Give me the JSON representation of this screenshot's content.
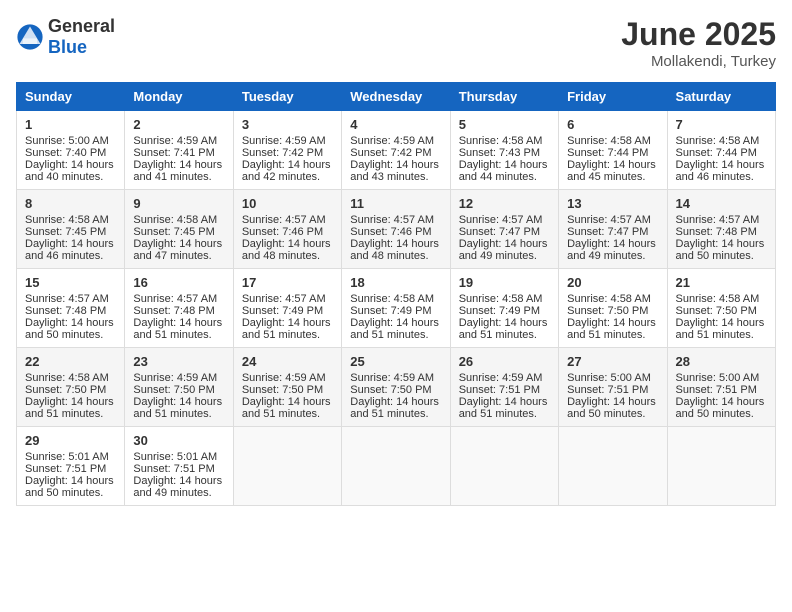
{
  "header": {
    "logo_general": "General",
    "logo_blue": "Blue",
    "title": "June 2025",
    "location": "Mollakendi, Turkey"
  },
  "weekdays": [
    "Sunday",
    "Monday",
    "Tuesday",
    "Wednesday",
    "Thursday",
    "Friday",
    "Saturday"
  ],
  "weeks": [
    [
      {
        "day": "1",
        "sunrise": "5:00 AM",
        "sunset": "7:40 PM",
        "daylight": "14 hours and 40 minutes."
      },
      {
        "day": "2",
        "sunrise": "4:59 AM",
        "sunset": "7:41 PM",
        "daylight": "14 hours and 41 minutes."
      },
      {
        "day": "3",
        "sunrise": "4:59 AM",
        "sunset": "7:42 PM",
        "daylight": "14 hours and 42 minutes."
      },
      {
        "day": "4",
        "sunrise": "4:59 AM",
        "sunset": "7:42 PM",
        "daylight": "14 hours and 43 minutes."
      },
      {
        "day": "5",
        "sunrise": "4:58 AM",
        "sunset": "7:43 PM",
        "daylight": "14 hours and 44 minutes."
      },
      {
        "day": "6",
        "sunrise": "4:58 AM",
        "sunset": "7:44 PM",
        "daylight": "14 hours and 45 minutes."
      },
      {
        "day": "7",
        "sunrise": "4:58 AM",
        "sunset": "7:44 PM",
        "daylight": "14 hours and 46 minutes."
      }
    ],
    [
      {
        "day": "8",
        "sunrise": "4:58 AM",
        "sunset": "7:45 PM",
        "daylight": "14 hours and 46 minutes."
      },
      {
        "day": "9",
        "sunrise": "4:58 AM",
        "sunset": "7:45 PM",
        "daylight": "14 hours and 47 minutes."
      },
      {
        "day": "10",
        "sunrise": "4:57 AM",
        "sunset": "7:46 PM",
        "daylight": "14 hours and 48 minutes."
      },
      {
        "day": "11",
        "sunrise": "4:57 AM",
        "sunset": "7:46 PM",
        "daylight": "14 hours and 48 minutes."
      },
      {
        "day": "12",
        "sunrise": "4:57 AM",
        "sunset": "7:47 PM",
        "daylight": "14 hours and 49 minutes."
      },
      {
        "day": "13",
        "sunrise": "4:57 AM",
        "sunset": "7:47 PM",
        "daylight": "14 hours and 49 minutes."
      },
      {
        "day": "14",
        "sunrise": "4:57 AM",
        "sunset": "7:48 PM",
        "daylight": "14 hours and 50 minutes."
      }
    ],
    [
      {
        "day": "15",
        "sunrise": "4:57 AM",
        "sunset": "7:48 PM",
        "daylight": "14 hours and 50 minutes."
      },
      {
        "day": "16",
        "sunrise": "4:57 AM",
        "sunset": "7:48 PM",
        "daylight": "14 hours and 51 minutes."
      },
      {
        "day": "17",
        "sunrise": "4:57 AM",
        "sunset": "7:49 PM",
        "daylight": "14 hours and 51 minutes."
      },
      {
        "day": "18",
        "sunrise": "4:58 AM",
        "sunset": "7:49 PM",
        "daylight": "14 hours and 51 minutes."
      },
      {
        "day": "19",
        "sunrise": "4:58 AM",
        "sunset": "7:49 PM",
        "daylight": "14 hours and 51 minutes."
      },
      {
        "day": "20",
        "sunrise": "4:58 AM",
        "sunset": "7:50 PM",
        "daylight": "14 hours and 51 minutes."
      },
      {
        "day": "21",
        "sunrise": "4:58 AM",
        "sunset": "7:50 PM",
        "daylight": "14 hours and 51 minutes."
      }
    ],
    [
      {
        "day": "22",
        "sunrise": "4:58 AM",
        "sunset": "7:50 PM",
        "daylight": "14 hours and 51 minutes."
      },
      {
        "day": "23",
        "sunrise": "4:59 AM",
        "sunset": "7:50 PM",
        "daylight": "14 hours and 51 minutes."
      },
      {
        "day": "24",
        "sunrise": "4:59 AM",
        "sunset": "7:50 PM",
        "daylight": "14 hours and 51 minutes."
      },
      {
        "day": "25",
        "sunrise": "4:59 AM",
        "sunset": "7:50 PM",
        "daylight": "14 hours and 51 minutes."
      },
      {
        "day": "26",
        "sunrise": "4:59 AM",
        "sunset": "7:51 PM",
        "daylight": "14 hours and 51 minutes."
      },
      {
        "day": "27",
        "sunrise": "5:00 AM",
        "sunset": "7:51 PM",
        "daylight": "14 hours and 50 minutes."
      },
      {
        "day": "28",
        "sunrise": "5:00 AM",
        "sunset": "7:51 PM",
        "daylight": "14 hours and 50 minutes."
      }
    ],
    [
      {
        "day": "29",
        "sunrise": "5:01 AM",
        "sunset": "7:51 PM",
        "daylight": "14 hours and 50 minutes."
      },
      {
        "day": "30",
        "sunrise": "5:01 AM",
        "sunset": "7:51 PM",
        "daylight": "14 hours and 49 minutes."
      },
      null,
      null,
      null,
      null,
      null
    ]
  ],
  "labels": {
    "sunrise": "Sunrise:",
    "sunset": "Sunset:",
    "daylight": "Daylight:"
  }
}
